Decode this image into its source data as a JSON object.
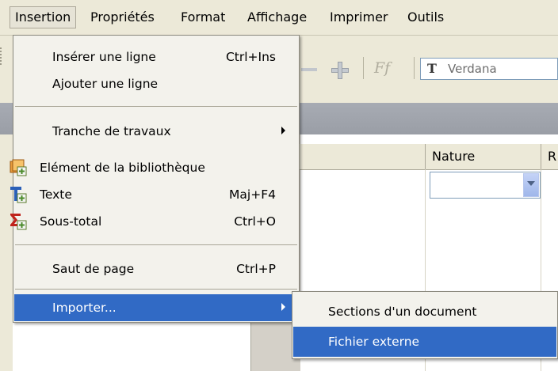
{
  "menubar": {
    "items": [
      {
        "label": "Insertion"
      },
      {
        "label": "Propriétés"
      },
      {
        "label": "Format"
      },
      {
        "label": "Affichage"
      },
      {
        "label": "Imprimer"
      },
      {
        "label": "Outils"
      }
    ]
  },
  "toolbar": {
    "font_name": "Verdana",
    "font_icon_glyph": "T",
    "ff_glyph": "Ff"
  },
  "grid": {
    "headers": [
      "Nature",
      "R"
    ],
    "nature_value": ""
  },
  "insertion_menu": {
    "items": [
      {
        "label": "Insérer une ligne",
        "shortcut": "Ctrl+Ins"
      },
      {
        "label": "Ajouter une ligne",
        "shortcut": ""
      },
      {
        "label": "Tranche de travaux",
        "shortcut": "",
        "submenu": true
      },
      {
        "label": "Elément de la bibliothèque",
        "shortcut": "",
        "icon": "library-element-icon"
      },
      {
        "label": "Texte",
        "shortcut": "Maj+F4",
        "icon": "text-insert-icon"
      },
      {
        "label": "Sous-total",
        "shortcut": "Ctrl+O",
        "icon": "subtotal-icon"
      },
      {
        "label": "Saut de page",
        "shortcut": "Ctrl+P"
      },
      {
        "label": "Importer...",
        "shortcut": "",
        "submenu": true,
        "highlighted": true
      }
    ]
  },
  "import_submenu": {
    "items": [
      {
        "label": "Sections d'un document"
      },
      {
        "label": "Fichier externe",
        "highlighted": true
      }
    ]
  },
  "colors": {
    "highlight": "#316ac5",
    "menu_bg": "#f3f2ec",
    "chrome_bg": "#ece9d8"
  }
}
